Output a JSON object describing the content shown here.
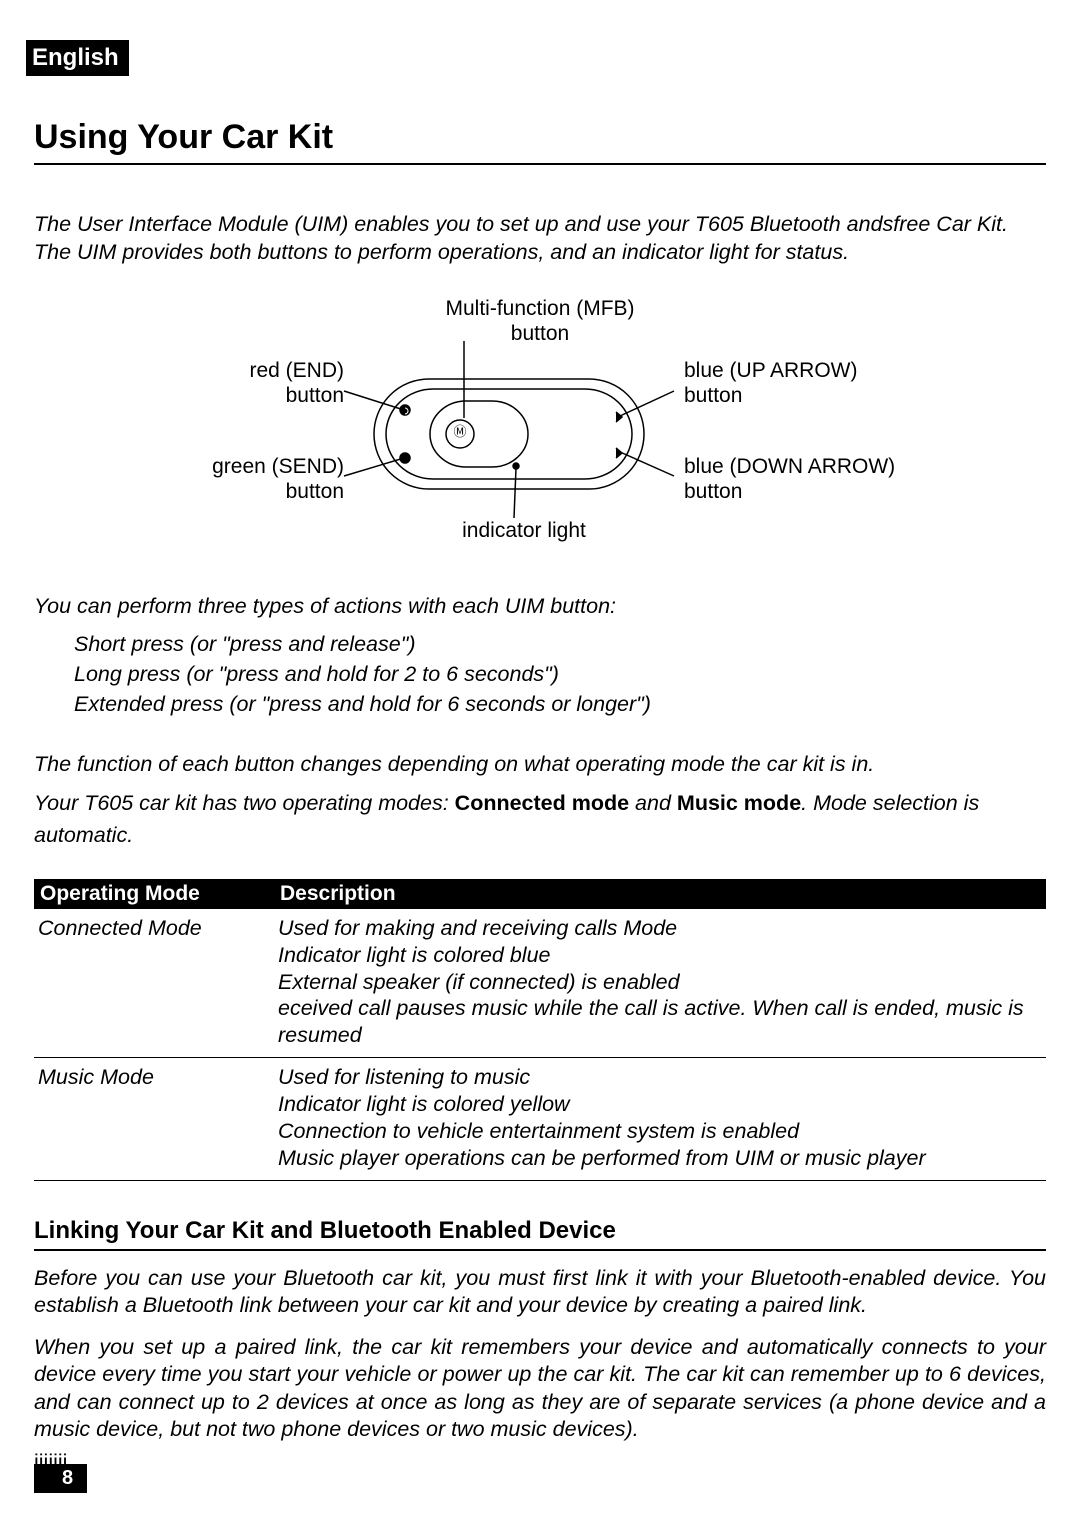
{
  "lang_tag": "English",
  "section_title": "Using Your Car Kit",
  "intro": "The User Interface Module (UIM) enables you to set up and use your T605 Bluetooth  andsfree Car Kit. The UIM provides both buttons to perform operations, and an indicator light for status.",
  "diagram": {
    "mfb": "Multi-function (MFB) button",
    "red": "red (END) button",
    "green": "green (SEND) button",
    "indicator": "indicator light",
    "up": "blue (UP ARROW) button",
    "down": "blue (DOWN ARROW) button"
  },
  "actions_intro": "You can perform three types of actions with each UIM button:",
  "actions": [
    "Short press (or \"press and release\")",
    "Long press (or \"press and hold for 2 to 6 seconds\")",
    "Extended press (or \"press and hold for 6 seconds or longer\")"
  ],
  "mode_para1": "The function of each button changes depending on what operating mode the car kit is in.",
  "mode_para2_a": "Your T605 car kit has two operating modes: ",
  "mode_para2_b": "Connected mode",
  "mode_para2_c": " and ",
  "mode_para2_d": "Music mode",
  "mode_para2_e": ". Mode selection is automatic.",
  "table": {
    "h1": "Operating Mode",
    "h2": "Description",
    "rows": [
      {
        "mode": "Connected Mode",
        "desc": "Used for making and receiving calls Mode\nIndicator light is colored blue\nExternal speaker (if connected) is enabled\n eceived call pauses music while the call is active. When call is ended, music is resumed"
      },
      {
        "mode": "Music Mode",
        "desc": "Used for listening to music\nIndicator light is colored yellow\nConnection to vehicle entertainment system is enabled\nMusic player operations can be performed from UIM or music player"
      }
    ]
  },
  "subsection_title": "Linking Your Car Kit and Bluetooth Enabled Device",
  "sub_para1": "Before you can use your Bluetooth car kit, you must first link it with your Bluetooth-enabled device. You establish a Bluetooth link between your car kit and your device by creating a paired link.",
  "sub_para2": "When you set up a paired link, the car kit remembers your device and automatically connects to your device every time you start your vehicle or power up the car kit. The car kit can remember up to 6 devices, and can connect up to 2 devices at once as long as they are of separate services (a phone device and a music device, but not two phone devices or two music devices).",
  "trail": "iiiiiii",
  "page_number": "8"
}
